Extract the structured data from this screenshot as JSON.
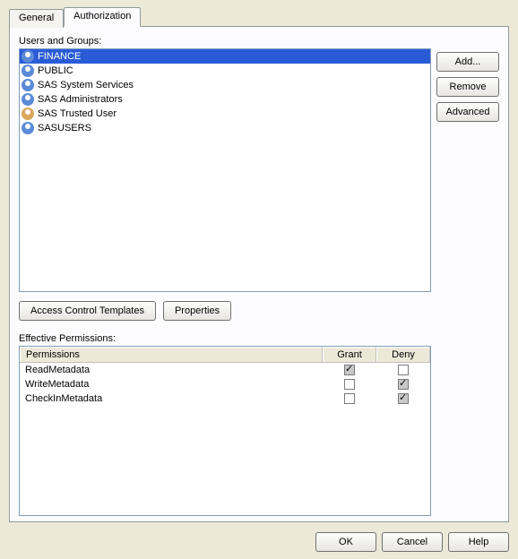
{
  "tabs": {
    "general": "General",
    "authorization": "Authorization"
  },
  "labels": {
    "users_groups": "Users and Groups:",
    "effective_permissions": "Effective Permissions:"
  },
  "users_groups": {
    "items": [
      {
        "label": "FINANCE",
        "type": "group",
        "selected": true
      },
      {
        "label": "PUBLIC",
        "type": "group",
        "selected": false
      },
      {
        "label": "SAS System Services",
        "type": "group",
        "selected": false
      },
      {
        "label": "SAS Administrators",
        "type": "group",
        "selected": false
      },
      {
        "label": "SAS Trusted User",
        "type": "user",
        "selected": false
      },
      {
        "label": "SASUSERS",
        "type": "group",
        "selected": false
      }
    ]
  },
  "buttons": {
    "add": "Add...",
    "remove": "Remove",
    "advanced": "Advanced",
    "act": "Access Control Templates",
    "properties": "Properties",
    "ok": "OK",
    "cancel": "Cancel",
    "help": "Help"
  },
  "permissions": {
    "headers": {
      "permissions": "Permissions",
      "grant": "Grant",
      "deny": "Deny"
    },
    "rows": [
      {
        "name": "ReadMetadata",
        "grant": true,
        "deny": false
      },
      {
        "name": "WriteMetadata",
        "grant": false,
        "deny": true
      },
      {
        "name": "CheckInMetadata",
        "grant": false,
        "deny": true
      }
    ]
  }
}
